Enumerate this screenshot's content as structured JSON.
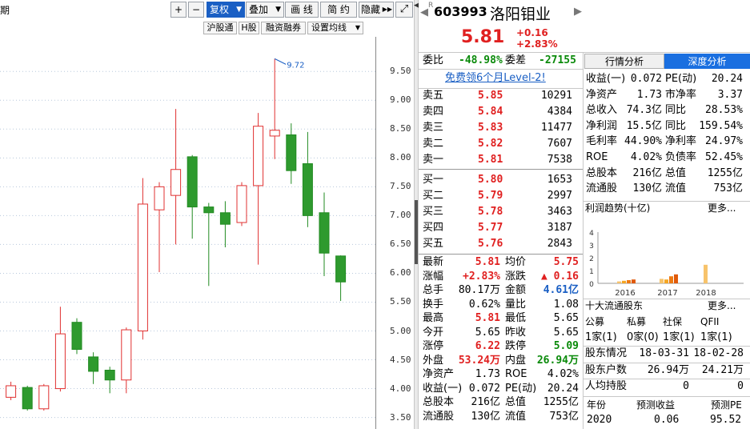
{
  "toolbar": {
    "period_label": "期",
    "plus": "+",
    "minus": "−",
    "fuquan": "复权",
    "diejia": "叠加",
    "huaxian": "画 线",
    "jianyue": "简 约",
    "yincang": "隐藏"
  },
  "subtoolbar": {
    "hgt": "沪股通",
    "hshare": "H股",
    "rzrq": "融资融券",
    "setma": "设置均线"
  },
  "chart_data": {
    "type": "candlestick",
    "y_ticks": [
      "9.50",
      "9.00",
      "8.50",
      "8.00",
      "7.50",
      "7.00",
      "6.50",
      "6.00",
      "5.50",
      "5.00",
      "4.50",
      "4.00",
      "3.50"
    ],
    "ylim": [
      3.3,
      10.1
    ],
    "high_annotation": "9.72",
    "candles": [
      {
        "o": 3.68,
        "c": 3.72,
        "h": 3.75,
        "l": 3.6
      },
      {
        "o": 3.85,
        "c": 4.05,
        "h": 4.12,
        "l": 3.8
      },
      {
        "o": 4.02,
        "c": 3.65,
        "h": 4.05,
        "l": 3.62
      },
      {
        "o": 3.65,
        "c": 4.05,
        "h": 4.08,
        "l": 3.62
      },
      {
        "o": 4.0,
        "c": 4.95,
        "h": 5.42,
        "l": 3.95
      },
      {
        "o": 5.15,
        "c": 4.68,
        "h": 5.22,
        "l": 4.6
      },
      {
        "o": 4.55,
        "c": 4.3,
        "h": 4.63,
        "l": 4.08
      },
      {
        "o": 4.32,
        "c": 4.15,
        "h": 4.38,
        "l": 3.92
      },
      {
        "o": 4.15,
        "c": 5.02,
        "h": 5.06,
        "l": 3.92
      },
      {
        "o": 5.0,
        "c": 7.2,
        "h": 7.65,
        "l": 4.85
      },
      {
        "o": 7.1,
        "c": 7.5,
        "h": 7.58,
        "l": 6.02
      },
      {
        "o": 7.35,
        "c": 7.8,
        "h": 8.85,
        "l": 6.5
      },
      {
        "o": 8.02,
        "c": 7.15,
        "h": 8.05,
        "l": 6.6
      },
      {
        "o": 7.15,
        "c": 7.05,
        "h": 7.22,
        "l": 5.78
      },
      {
        "o": 7.05,
        "c": 6.85,
        "h": 7.25,
        "l": 6.45
      },
      {
        "o": 6.88,
        "c": 7.52,
        "h": 7.58,
        "l": 6.82
      },
      {
        "o": 7.52,
        "c": 8.55,
        "h": 8.78,
        "l": 6.15
      },
      {
        "o": 8.38,
        "c": 8.48,
        "h": 9.72,
        "l": 7.98
      },
      {
        "o": 8.4,
        "c": 7.78,
        "h": 8.6,
        "l": 7.55
      },
      {
        "o": 7.9,
        "c": 7.0,
        "h": 8.45,
        "l": 6.8
      },
      {
        "o": 7.05,
        "c": 6.35,
        "h": 7.4,
        "l": 5.95
      },
      {
        "o": 6.3,
        "c": 5.85,
        "h": 6.31,
        "l": 5.52
      }
    ]
  },
  "quote": {
    "code": "603993",
    "name": "洛阳钼业",
    "price": "5.81",
    "change": "+0.16",
    "change_pct": "+2.83%",
    "weibi_label": "委比",
    "weibi": "-48.98%",
    "weicha_label": "委差",
    "weicha": "-27155",
    "level2": "免费领6个月Level-2!"
  },
  "sells": [
    {
      "label": "卖五",
      "price": "5.85",
      "vol": "10291"
    },
    {
      "label": "卖四",
      "price": "5.84",
      "vol": "4384"
    },
    {
      "label": "卖三",
      "price": "5.83",
      "vol": "11477"
    },
    {
      "label": "卖二",
      "price": "5.82",
      "vol": "7607"
    },
    {
      "label": "卖一",
      "price": "5.81",
      "vol": "7538"
    }
  ],
  "buys": [
    {
      "label": "买一",
      "price": "5.80",
      "vol": "1653"
    },
    {
      "label": "买二",
      "price": "5.79",
      "vol": "2997"
    },
    {
      "label": "买三",
      "price": "5.78",
      "vol": "3463"
    },
    {
      "label": "买四",
      "price": "5.77",
      "vol": "3187"
    },
    {
      "label": "买五",
      "price": "5.76",
      "vol": "2843"
    }
  ],
  "stats": [
    {
      "l1": "最新",
      "v1": "5.81",
      "c1": "red",
      "l2": "均价",
      "v2": "5.75",
      "c2": "red"
    },
    {
      "l1": "涨幅",
      "v1": "+2.83%",
      "c1": "red",
      "l2": "涨跌",
      "v2": "▲ 0.16",
      "c2": "red"
    },
    {
      "l1": "总手",
      "v1": "80.17万",
      "c1": "black",
      "l2": "金额",
      "v2": "4.61亿",
      "c2": "blue"
    },
    {
      "l1": "换手",
      "v1": "0.62%",
      "c1": "black",
      "l2": "量比",
      "v2": "1.08",
      "c2": "black"
    },
    {
      "l1": "最高",
      "v1": "5.81",
      "c1": "red",
      "l2": "最低",
      "v2": "5.65",
      "c2": "black"
    },
    {
      "l1": "今开",
      "v1": "5.65",
      "c1": "black",
      "l2": "昨收",
      "v2": "5.65",
      "c2": "black"
    },
    {
      "l1": "涨停",
      "v1": "6.22",
      "c1": "red",
      "l2": "跌停",
      "v2": "5.09",
      "c2": "green"
    },
    {
      "l1": "外盘",
      "v1": "53.24万",
      "c1": "red",
      "l2": "内盘",
      "v2": "26.94万",
      "c2": "green"
    },
    {
      "l1": "净资产",
      "v1": "1.73",
      "c1": "black",
      "l2": "ROE",
      "v2": "4.02%",
      "c2": "black"
    },
    {
      "l1": "收益(一)",
      "v1": "0.072",
      "c1": "black",
      "l2": "PE(动)",
      "v2": "20.24",
      "c2": "black"
    },
    {
      "l1": "总股本",
      "v1": "216亿",
      "c1": "black",
      "l2": "总值",
      "v2": "1255亿",
      "c2": "black"
    },
    {
      "l1": "流通股",
      "v1": "130亿",
      "c1": "black",
      "l2": "流值",
      "v2": "753亿",
      "c2": "black"
    }
  ],
  "tabs": {
    "hangqing": "行情分析",
    "shendu": "深度分析"
  },
  "fundamentals": [
    {
      "l1": "收益(一)",
      "v1": "0.072",
      "l2": "PE(动)",
      "v2": "20.24"
    },
    {
      "l1": "净资产",
      "v1": "1.73",
      "l2": "市净率",
      "v2": "3.37"
    },
    {
      "l1": "总收入",
      "v1": "74.3亿",
      "l2": "同比",
      "v2": "28.53%"
    },
    {
      "l1": "净利润",
      "v1": "15.5亿",
      "l2": "同比",
      "v2": "159.54%"
    },
    {
      "l1": "毛利率",
      "v1": "44.90%",
      "l2": "净利率",
      "v2": "24.97%"
    },
    {
      "l1": "ROE",
      "v1": "4.02%",
      "l2": "负债率",
      "v2": "52.45%"
    },
    {
      "l1": "总股本",
      "v1": "216亿",
      "l2": "总值",
      "v2": "1255亿"
    },
    {
      "l1": "流通股",
      "v1": "130亿",
      "l2": "流值",
      "v2": "753亿"
    }
  ],
  "profit": {
    "title": "利润趋势(十亿)",
    "more": "更多",
    "y_ticks": [
      "4",
      "3",
      "2",
      "1",
      "0"
    ],
    "years": [
      "2016",
      "2017",
      "2018"
    ],
    "bars": [
      [
        0.15,
        0.2,
        0.25,
        0.3
      ],
      [
        0.35,
        0.3,
        0.55,
        0.7
      ],
      [
        1.45
      ]
    ]
  },
  "holders": {
    "title": "十大流通股东",
    "more": "更多",
    "headers": [
      "公募",
      "私募",
      "社保",
      "QFII"
    ],
    "values": [
      "1家(1)",
      "0家(0)",
      "1家(1)",
      "1家(1)"
    ]
  },
  "shareholders": [
    {
      "label": "股东情况",
      "v1": "18-03-31",
      "v2": "18-02-28"
    },
    {
      "label": "股东户数",
      "v1": "26.94万",
      "v2": "24.21万"
    },
    {
      "label": "人均持股",
      "v1": "0",
      "v2": "0"
    }
  ],
  "forecast": {
    "headers": [
      "年份",
      "预测收益",
      "预测PE"
    ],
    "row": [
      "2020",
      "0.06",
      "95.52"
    ]
  }
}
